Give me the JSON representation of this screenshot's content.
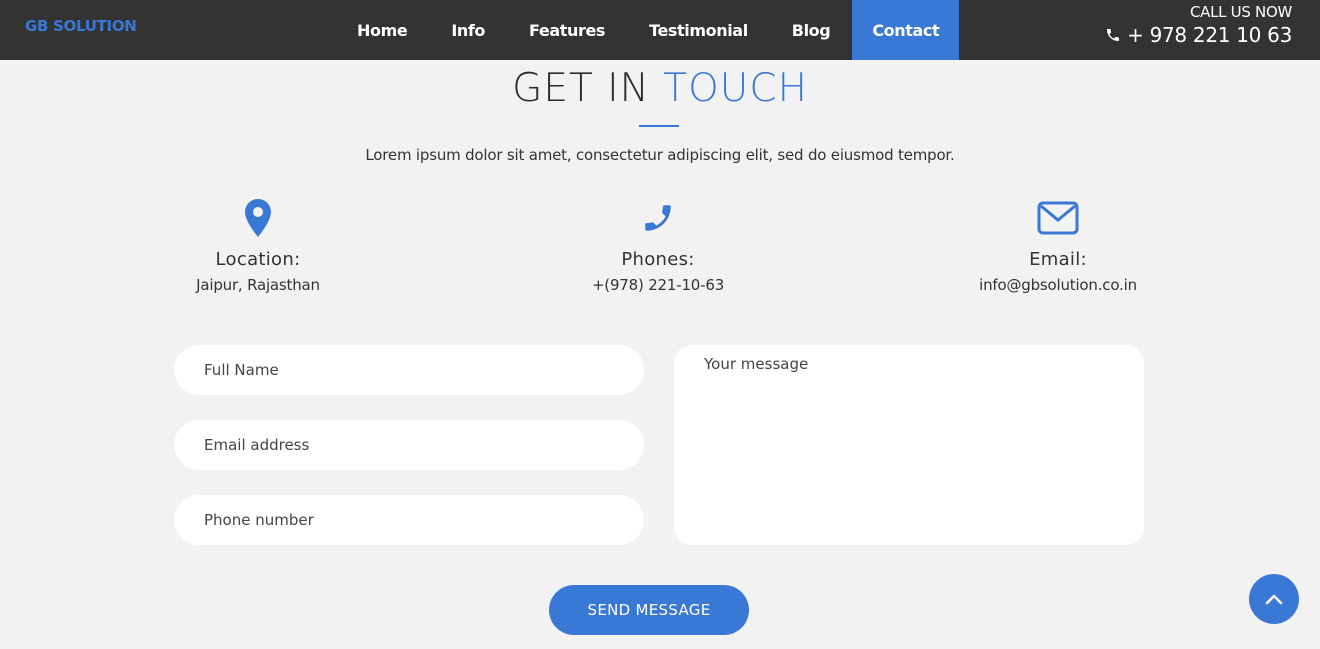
{
  "brand": "GB SOLUTION",
  "nav": {
    "items": [
      {
        "label": "Home"
      },
      {
        "label": "Info"
      },
      {
        "label": "Features"
      },
      {
        "label": "Testimonial"
      },
      {
        "label": "Blog"
      },
      {
        "label": "Contact",
        "active": true
      }
    ]
  },
  "call": {
    "label": "CALL US NOW",
    "number": "+ 978 221 10 63",
    "icon": "phone-icon"
  },
  "section": {
    "title_part1": "GET IN",
    "title_part2": "TOUCH",
    "lead": "Lorem ipsum dolor sit amet, consectetur adipiscing elit, sed do eiusmod tempor."
  },
  "contacts": [
    {
      "icon": "map-marker-icon",
      "title": "Location:",
      "value": "Jaipur, Rajasthan"
    },
    {
      "icon": "phone-icon",
      "title": "Phones:",
      "value": "+(978) 221-10-63"
    },
    {
      "icon": "envelope-icon",
      "title": "Email:",
      "value": "info@gbsolution.co.in"
    }
  ],
  "form": {
    "name_placeholder": "Full Name",
    "email_placeholder": "Email address",
    "phone_placeholder": "Phone number",
    "message_placeholder": "Your message",
    "submit_label": "SEND MESSAGE"
  },
  "colors": {
    "accent": "#3a78d6",
    "navbar": "#333333",
    "background": "#f2f2f2"
  }
}
